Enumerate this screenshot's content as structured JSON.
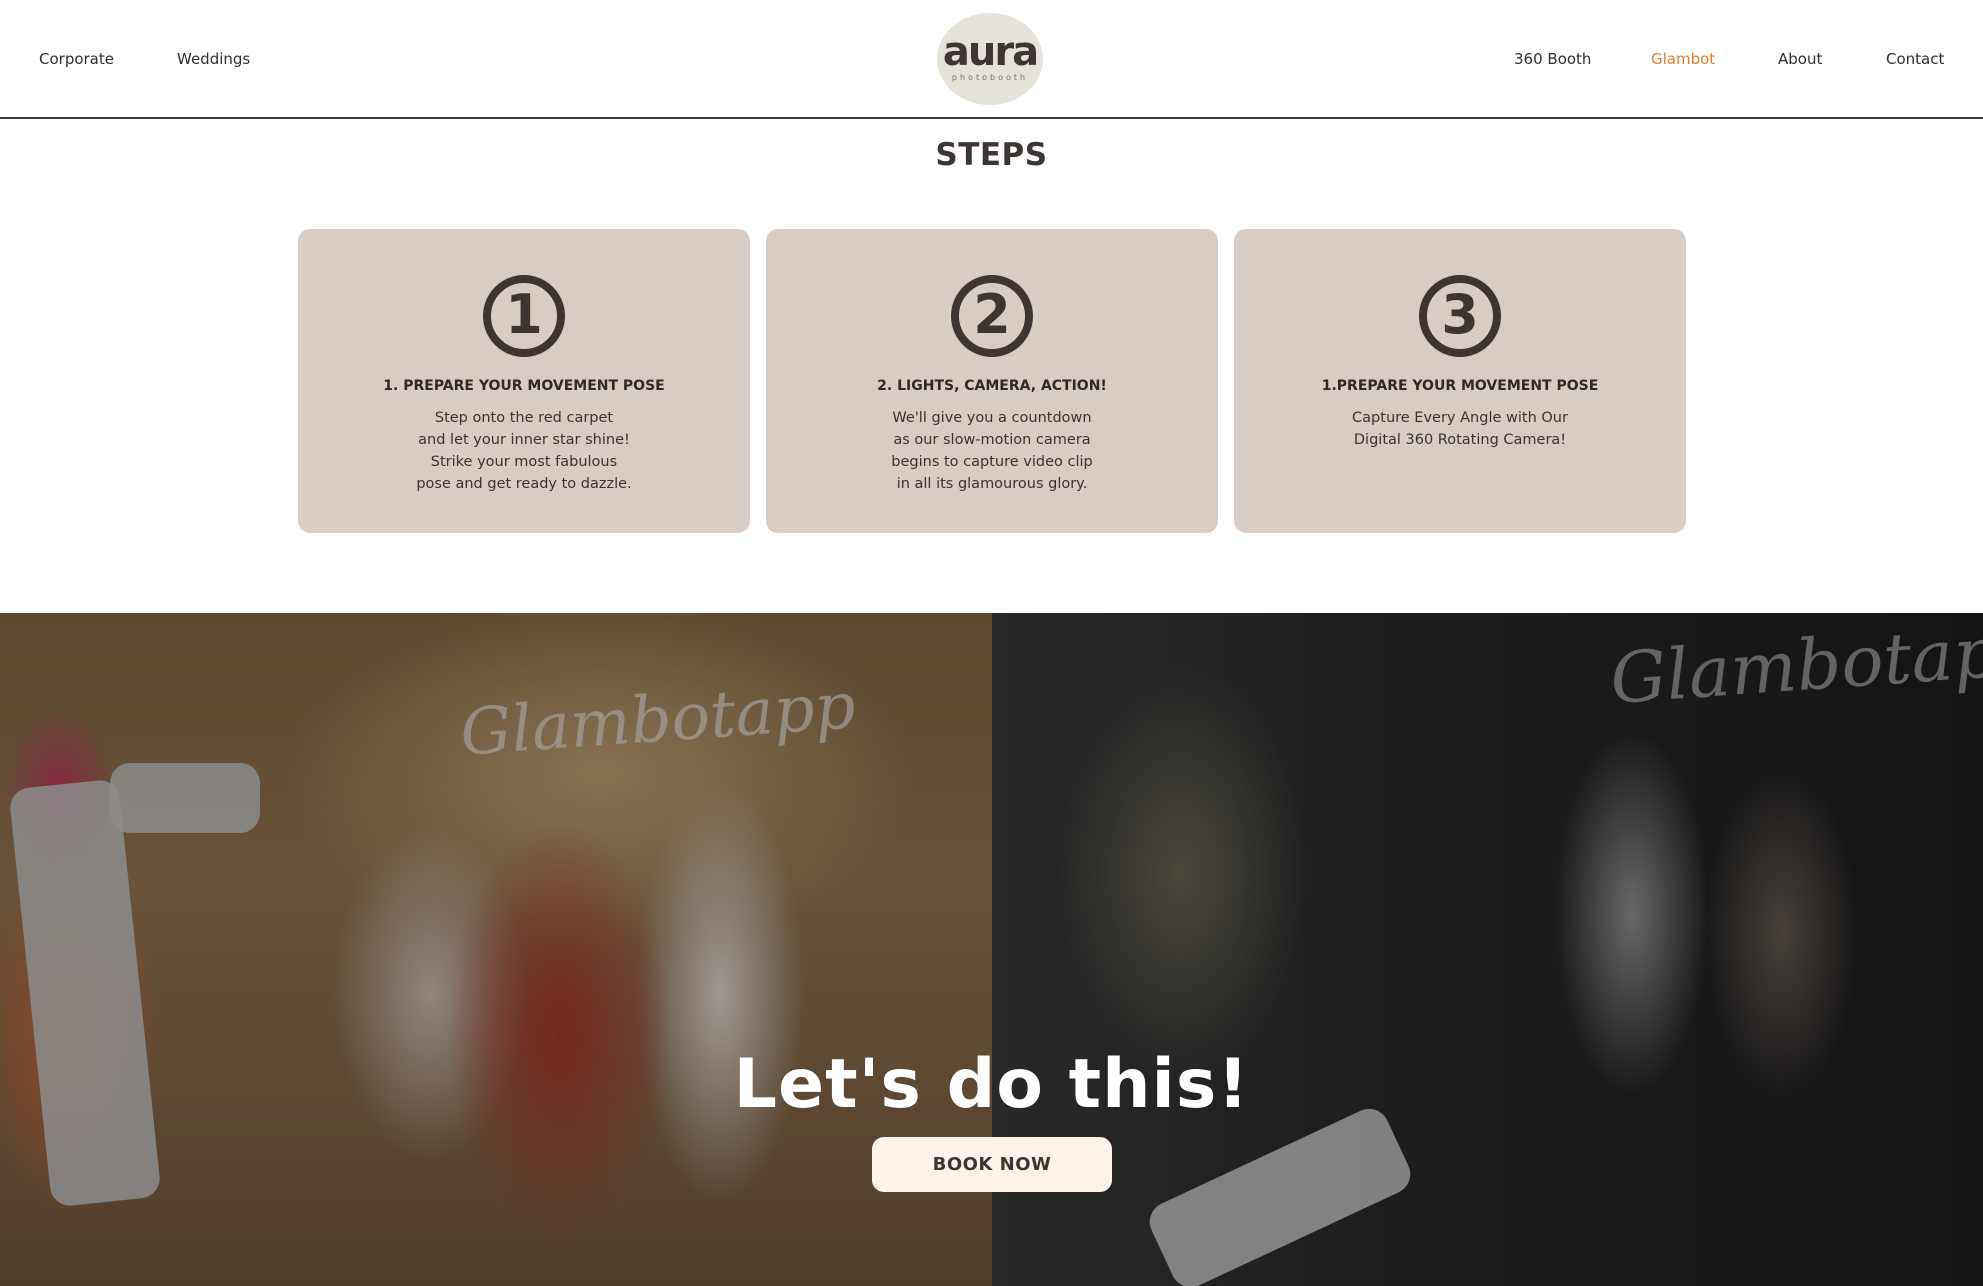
{
  "header": {
    "nav_left": [
      "Corporate",
      "Weddings"
    ],
    "nav_right": [
      "360 Booth",
      "Glambot",
      "About",
      "Contact"
    ],
    "active_item": "Glambot",
    "logo": {
      "word": "aura",
      "sub": "photobooth"
    }
  },
  "steps": {
    "title": "STEPS",
    "cards": [
      {
        "number": "1",
        "title": "1. PREPARE YOUR MOVEMENT POSE",
        "body": [
          "Step onto the red carpet",
          "and let your inner star shine!",
          "Strike your most fabulous",
          "pose and get ready to dazzle."
        ]
      },
      {
        "number": "2",
        "title": "2. LIGHTS, CAMERA, ACTION!",
        "body": [
          "We'll give you a countdown",
          "as our slow-motion camera",
          "begins to capture video clip",
          "in all its glamourous glory."
        ]
      },
      {
        "number": "3",
        "title": "1.PREPARE YOUR MOVEMENT POSE",
        "body": [
          "Capture Every Angle with Our",
          "Digital 360 Rotating Camera!"
        ]
      }
    ]
  },
  "hero": {
    "heading": "Let's do this!",
    "button": "BOOK NOW",
    "neon_text": "Glambotapp"
  },
  "colors": {
    "accent": "#e27c2e",
    "card_bg": "#d8cdc4",
    "text_dark": "#3d3533",
    "button_bg": "#fdf3e8"
  }
}
